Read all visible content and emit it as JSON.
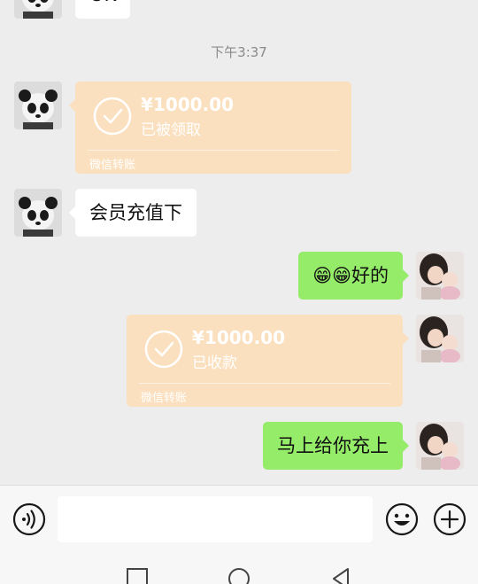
{
  "messages": {
    "top_partial": {
      "text": "OK"
    },
    "timestamp": "下午3:37",
    "transfer_received": {
      "amount": "¥1000.00",
      "status": "已被领取",
      "label": "微信转账"
    },
    "incoming_text": "会员充值下",
    "outgoing_emoji_text": "😁😁好的",
    "transfer_sent": {
      "amount": "¥1000.00",
      "status": "已收款",
      "label": "微信转账"
    },
    "outgoing_text": "马上给你充上"
  },
  "input_bar": {
    "voice_icon": "voice-icon",
    "message_value": "",
    "emoji_icon": "emoji-icon",
    "plus_icon": "plus-icon"
  },
  "nav_bar": {
    "icons": [
      "square-icon",
      "circle-icon",
      "triangle-back-icon"
    ]
  },
  "colors": {
    "background": "#ededed",
    "outgoing_bubble": "#95ec69",
    "incoming_bubble": "#ffffff",
    "transfer_card": "#fbe0bf"
  }
}
